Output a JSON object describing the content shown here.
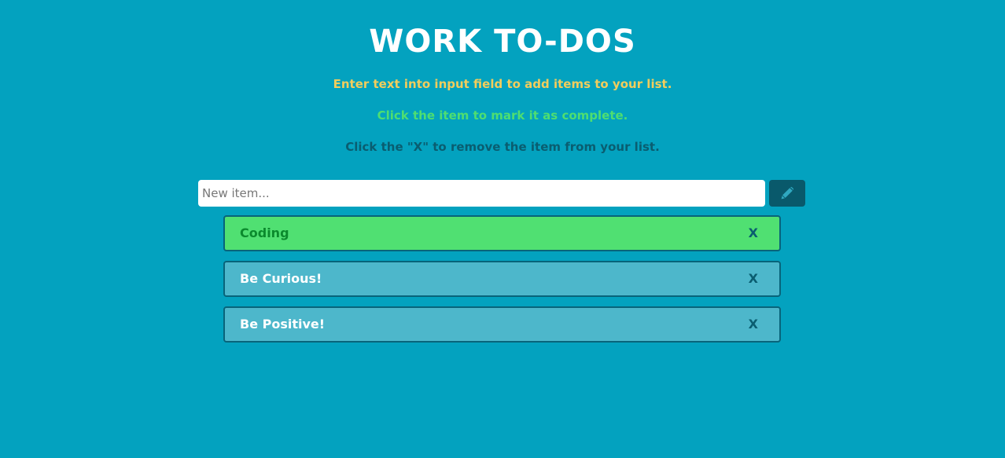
{
  "header": {
    "title": "WORK TO-DOS",
    "instructions": [
      "Enter text into input field to add items to your list.",
      "Click the item to mark it as complete.",
      "Click the \"X\" to remove the item from your list."
    ]
  },
  "new_item": {
    "value": "",
    "placeholder": "New item...",
    "button_icon": "pencil-icon"
  },
  "todos": [
    {
      "label": "Coding",
      "completed": true,
      "remove_label": "X"
    },
    {
      "label": "Be Curious!",
      "completed": false,
      "remove_label": "X"
    },
    {
      "label": "Be Positive!",
      "completed": false,
      "remove_label": "X"
    }
  ],
  "colors": {
    "background": "#03a2bf",
    "completed_item": "#50e072",
    "pending_item": "#4db7cb",
    "dark_accent": "#09596b",
    "instruction_yellow": "#f2cd5c",
    "instruction_green": "#4ede71",
    "pencil_icon": "#2fa8c0"
  }
}
